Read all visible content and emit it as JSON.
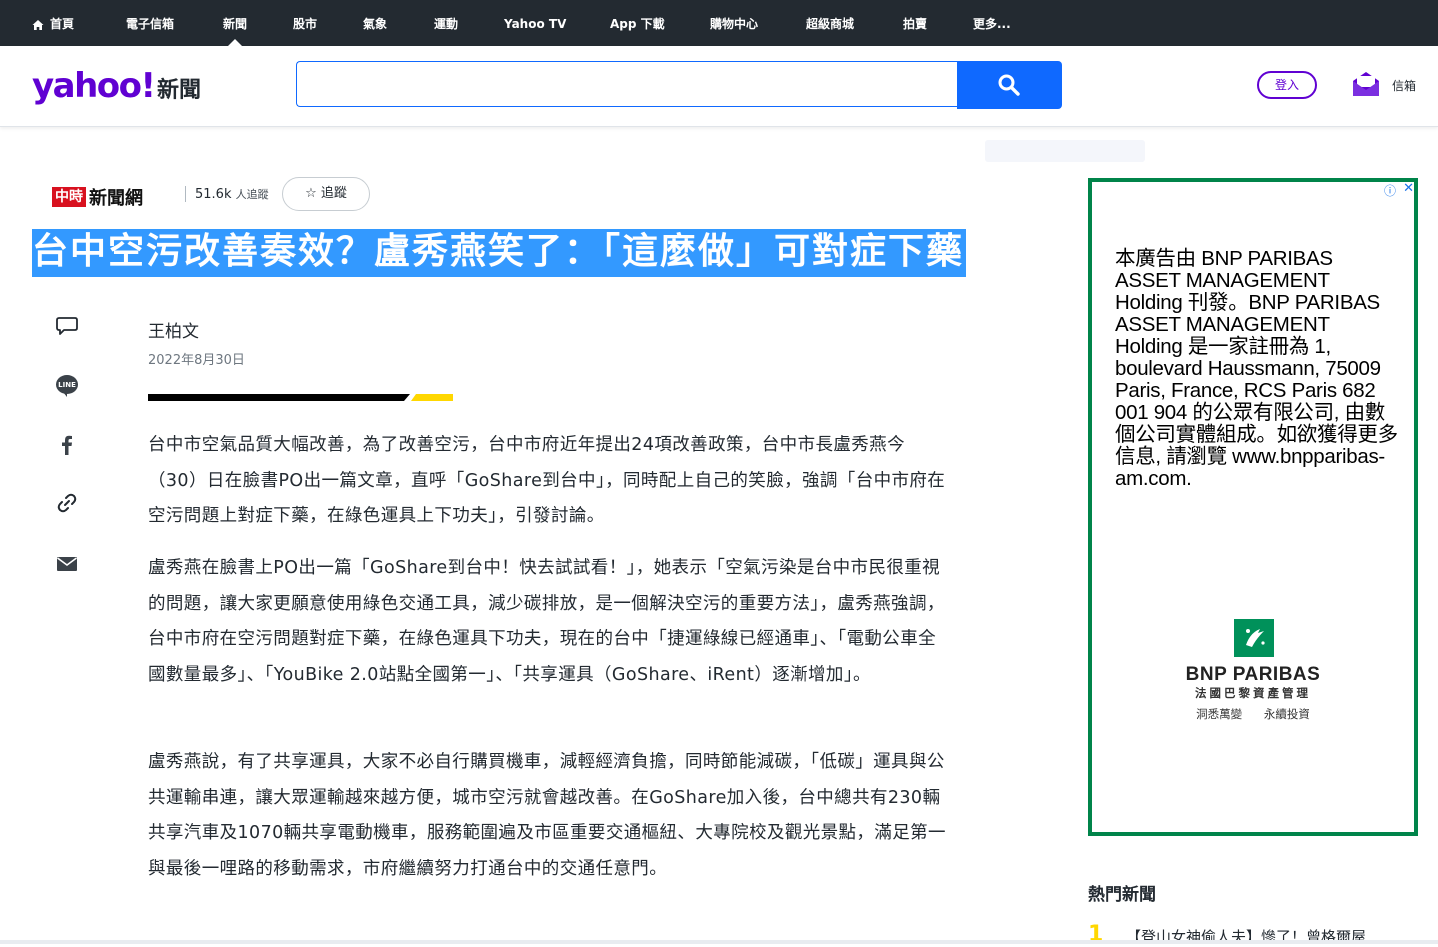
{
  "topnav": {
    "items": [
      {
        "label": "首頁"
      },
      {
        "label": "電子信箱"
      },
      {
        "label": "新聞"
      },
      {
        "label": "股市"
      },
      {
        "label": "氣象"
      },
      {
        "label": "運動"
      },
      {
        "label": "Yahoo TV"
      },
      {
        "label": "App 下載"
      },
      {
        "label": "購物中心"
      },
      {
        "label": "超級商城"
      },
      {
        "label": "拍賣"
      },
      {
        "label": "更多..."
      }
    ],
    "active": "新聞"
  },
  "header": {
    "logo": "yahoo!",
    "logo_sub": "新聞",
    "search_value": "",
    "login_label": "登入",
    "mail_label": "信箱"
  },
  "article": {
    "publisher_red": "中時",
    "publisher_black": "新聞網",
    "followers": "51.6k",
    "followers_label": "人追蹤",
    "follow_label": "追蹤",
    "title": "台中空污改善奏效？盧秀燕笑了：「這麼做」可對症下藥",
    "author": "王柏文",
    "date": "2022年8月30日",
    "paragraphs": [
      "台中市空氣品質大幅改善，為了改善空污，台中市府近年提出24項改善政策，台中市長盧秀燕今（30）日在臉書PO出一篇文章，直呼「GoShare到台中」，同時配上自己的笑臉，強調「台中市府在空污問題上對症下藥，在綠色運具上下功夫」，引發討論。",
      "盧秀燕在臉書上PO出一篇「GoShare到台中！快去試試看！」，她表示「空氣污染是台中市民很重視的問題，讓大家更願意使用綠色交通工具，減少碳排放，是一個解決空污的重要方法」，盧秀燕強調，台中市府在空污問題對症下藥，在綠色運具下功夫，現在的台中「捷運綠線已經通車」、「電動公車全國數量最多」、「YouBike 2.0站點全國第一」、「共享運具（GoShare、iRent）逐漸增加」。",
      "盧秀燕說，有了共享運具，大家不必自行購買機車，減輕經濟負擔，同時節能減碳，「低碳」運具與公共運輸串連，讓大眾運輸越來越方便，城市空污就會越改善。在GoShare加入後，台中總共有230輛共享汽車及1070輛共享電動機車，服務範圍遍及市區重要交通樞紐、大專院校及觀光景點，滿足第一與最後一哩路的移動需求，市府繼續努力打通台中的交通任意門。"
    ]
  },
  "ad": {
    "text": "本廣告由 BNP PARIBAS ASSET MANAGEMENT Holding 刊發。BNP PARIBAS ASSET MANAGEMENT Holding 是一家註冊為 1, boulevard Haussmann, 75009 Paris, France, RCS Paris 682 001 904 的公眾有限公司, 由數個公司實體組成。如欲獲得更多信息, 請瀏覽 www.bnpparibas-am.com.",
    "brand": "BNP PARIBAS",
    "brand_sub": "法國巴黎資產管理",
    "tagline": "洞悉萬變 永續投資",
    "adchoice": "ⓘ",
    "close": "✕",
    "border_color": "#00844a"
  },
  "hot": {
    "title": "熱門新聞",
    "first_num": "1",
    "first_item": "【登山女神偷人夫】慘了！曾格爾屋"
  },
  "colors": {
    "brand": "#6001d2",
    "search": "#0f69ff",
    "nav_bg": "#232a31",
    "highlight": "#3399ff"
  }
}
